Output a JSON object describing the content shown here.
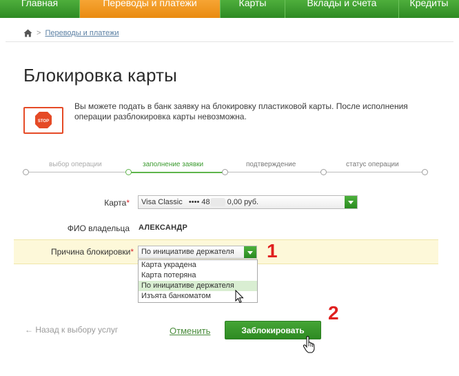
{
  "nav": {
    "items": [
      {
        "label": "Главная",
        "active": false
      },
      {
        "label": "Переводы и платежи",
        "active": true
      },
      {
        "label": "Карты",
        "active": false
      },
      {
        "label": "Вклады и счета",
        "active": false
      },
      {
        "label": "Кредиты",
        "active": false
      }
    ]
  },
  "breadcrumb": {
    "link": "Переводы и платежи",
    "separator": ">"
  },
  "page": {
    "title": "Блокировка карты"
  },
  "info": {
    "stop_label": "STOP",
    "text": "Вы можете подать в банк заявку на блокировку пластиковой карты. После исполнения операции разблокировка карты невозможна."
  },
  "steps": [
    {
      "label": "выбор операции",
      "state": "done"
    },
    {
      "label": "заполнение заявки",
      "state": "active"
    },
    {
      "label": "подтверждение",
      "state": "pending"
    },
    {
      "label": "статус операции",
      "state": "pending"
    }
  ],
  "form": {
    "card_label": "Карта",
    "card_value_name": "Visa Classic",
    "card_value_number": "•••• 48",
    "card_value_amount": "0,00  руб.",
    "owner_label": "ФИО владельца",
    "owner_value": "АЛЕКСАНДР",
    "reason_label": "Причина блокировки",
    "reason_value": "По инициативе держателя",
    "reason_options": [
      {
        "label": "Карта украдена",
        "selected": false
      },
      {
        "label": "Карта потеряна",
        "selected": false
      },
      {
        "label": "По инициативе держателя",
        "selected": true
      },
      {
        "label": "Изъята банкоматом",
        "selected": false
      }
    ],
    "required_mark": "*"
  },
  "annotations": {
    "one": "1",
    "two": "2"
  },
  "actions": {
    "back": "← Назад к выбору услуг",
    "cancel": "Отменить",
    "submit": "Заблокировать"
  },
  "colors": {
    "brand_green": "#2e8a23",
    "accent_orange": "#e98b10",
    "required_red": "#d9262c",
    "annotation_red": "#e0201f"
  }
}
